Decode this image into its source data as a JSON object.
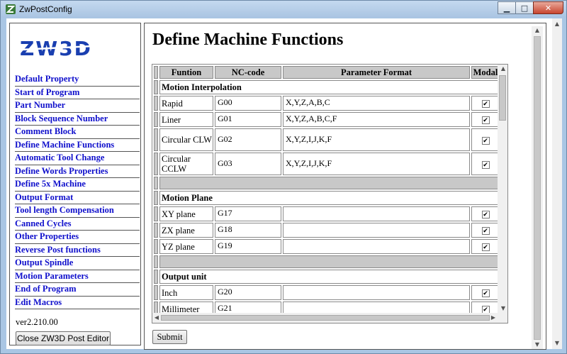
{
  "window": {
    "title": "ZwPostConfig",
    "min_glyph": "▁",
    "max_glyph": "□",
    "close_glyph": "✕"
  },
  "sidebar": {
    "logo_text": "ZW3D",
    "items": [
      {
        "label": "Default Property"
      },
      {
        "label": "Start of Program"
      },
      {
        "label": "Part Number"
      },
      {
        "label": "Block Sequence Number"
      },
      {
        "label": "Comment Block"
      },
      {
        "label": "Define Machine Functions"
      },
      {
        "label": "Automatic Tool Change"
      },
      {
        "label": "Define Words Properties"
      },
      {
        "label": "Define 5x Machine"
      },
      {
        "label": "Output Format"
      },
      {
        "label": "Tool length Compensation"
      },
      {
        "label": "Canned Cycles"
      },
      {
        "label": "Other Properties"
      },
      {
        "label": "Reverse Post functions"
      },
      {
        "label": "Output Spindle"
      },
      {
        "label": "Motion Parameters"
      },
      {
        "label": "End of Program"
      },
      {
        "label": "Edit Macros"
      }
    ],
    "version": "ver2.210.00",
    "close_button": "Close ZW3D Post Editor"
  },
  "main": {
    "title": "Define Machine Functions",
    "table": {
      "headers": {
        "function": "Funtion",
        "nc_code": "NC-code",
        "param_format": "Parameter Format",
        "modal": "Modal"
      },
      "sections": {
        "motion_interpolation": {
          "label": "Motion Interpolation",
          "rows": [
            {
              "function": "Rapid",
              "nc_code": "G00",
              "param": "X,Y,Z,A,B,C",
              "modal": "✔"
            },
            {
              "function": "Liner",
              "nc_code": "G01",
              "param": "X,Y,Z,A,B,C,F",
              "modal": "✔"
            },
            {
              "function": "Circular CLW",
              "nc_code": "G02",
              "param": "X,Y,Z,I,J,K,F",
              "modal": "✔"
            },
            {
              "function": "Circular CCLW",
              "nc_code": "G03",
              "param": "X,Y,Z,I,J,K,F",
              "modal": "✔"
            }
          ]
        },
        "motion_plane": {
          "label": "Motion Plane",
          "rows": [
            {
              "function": "XY plane",
              "nc_code": "G17",
              "param": "",
              "modal": "✔"
            },
            {
              "function": "ZX plane",
              "nc_code": "G18",
              "param": "",
              "modal": "✔"
            },
            {
              "function": "YZ plane",
              "nc_code": "G19",
              "param": "",
              "modal": "✔"
            }
          ]
        },
        "output_unit": {
          "label": "Output unit",
          "rows": [
            {
              "function": "Inch",
              "nc_code": "G20",
              "param": "",
              "modal": "✔"
            },
            {
              "function": "Millimeter",
              "nc_code": "G21",
              "param": "",
              "modal": "✔"
            }
          ]
        }
      }
    },
    "submit_label": "Submit"
  },
  "colors": {
    "link": "#1010cc",
    "header_bg": "#c8c8c8",
    "window_frame": "#a9c6e4",
    "logo": "#1a3fb0"
  },
  "scroll_arrows": {
    "up": "▲",
    "down": "▼",
    "left": "◀",
    "right": "▶"
  }
}
